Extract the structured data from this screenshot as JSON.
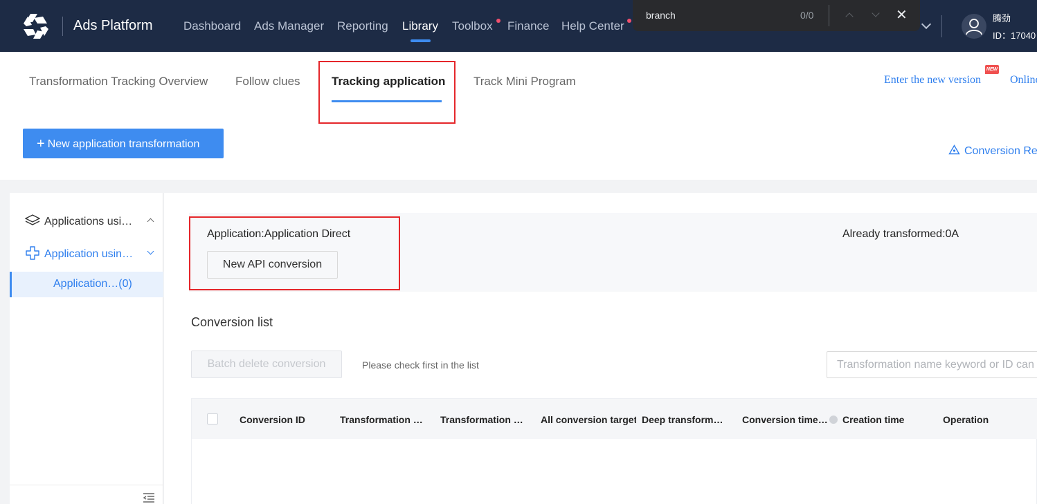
{
  "topbar": {
    "brand": "Ads Platform",
    "nav": [
      {
        "label": "Dashboard",
        "active": false,
        "dot": false
      },
      {
        "label": "Ads Manager",
        "active": false,
        "dot": false
      },
      {
        "label": "Reporting",
        "active": false,
        "dot": false
      },
      {
        "label": "Library",
        "active": true,
        "dot": false
      },
      {
        "label": "Toolbox",
        "active": false,
        "dot": true
      },
      {
        "label": "Finance",
        "active": false,
        "dot": false
      },
      {
        "label": "Help Center",
        "active": false,
        "dot": true
      }
    ],
    "user": {
      "name": "腾劲",
      "id": "ID：17040"
    }
  },
  "findbar": {
    "query": "branch",
    "count": "0/0",
    "close": "✕"
  },
  "tabs": {
    "items": [
      "Transformation Tracking Overview",
      "Follow clues",
      "Tracking application",
      "Track Mini Program"
    ],
    "active": "Tracking application",
    "new_version_link": "Enter the new version",
    "new_badge": "NEW",
    "online_link": "Online"
  },
  "actions": {
    "new_transformation": "New application transformation",
    "conversion_link": "Conversion Re"
  },
  "sidebar": {
    "group1": "Applications usi…",
    "group2": "Application usin…",
    "active_item": "Application…(0)"
  },
  "info": {
    "application": "Application:Application Direct",
    "new_api_button": "New API conversion",
    "transformed": "Already transformed:0A"
  },
  "list": {
    "title": "Conversion list",
    "batch_delete": "Batch delete conversion",
    "hint": "Please check first in the list",
    "search_placeholder": "Transformation name keyword or ID can",
    "columns": [
      "Conversion ID",
      "Transformation …",
      "Transformation …",
      "All conversion target",
      "Deep transform…",
      "Conversion time…",
      "Creation time",
      "Operation"
    ]
  },
  "colors": {
    "accent": "#3e8cf0",
    "topbar": "#1d2b45",
    "highlight": "#e5262a"
  }
}
